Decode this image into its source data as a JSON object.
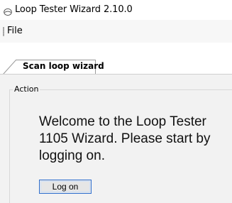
{
  "window": {
    "title": "Loop Tester Wizard 2.10.0",
    "icon": "loop-tester-app-icon"
  },
  "menu": {
    "items": [
      {
        "label": "File"
      }
    ]
  },
  "tabs": [
    {
      "label": "Scan loop wizard",
      "selected": true
    }
  ],
  "action_group": {
    "label": "Action",
    "message": "Welcome to the Loop Tester 1105 Wizard. Please start by logging on.",
    "button_label": "Log on"
  },
  "colors": {
    "button_focus_border": "#2f6fcf",
    "panel_background": "#f2f2f2"
  }
}
